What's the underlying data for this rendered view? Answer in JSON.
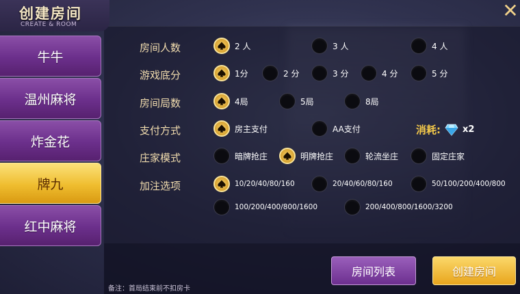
{
  "header": {
    "title": "创建房间",
    "subtitle": "CREATE & ROOM",
    "close_icon": "close-icon"
  },
  "sidebar": {
    "items": [
      {
        "label": "牛牛",
        "active": false
      },
      {
        "label": "温州麻将",
        "active": false
      },
      {
        "label": "炸金花",
        "active": false
      },
      {
        "label": "牌九",
        "active": true
      },
      {
        "label": "红中麻将",
        "active": false
      }
    ]
  },
  "form": {
    "players": {
      "label": "房间人数",
      "options": [
        {
          "label": "2 人",
          "selected": true
        },
        {
          "label": "3 人",
          "selected": false
        },
        {
          "label": "4 人",
          "selected": false
        }
      ]
    },
    "base_score": {
      "label": "游戏底分",
      "options": [
        {
          "label": "1分",
          "selected": true
        },
        {
          "label": "2 分",
          "selected": false
        },
        {
          "label": "3 分",
          "selected": false
        },
        {
          "label": "4 分",
          "selected": false
        },
        {
          "label": "5 分",
          "selected": false
        }
      ]
    },
    "rounds": {
      "label": "房间局数",
      "options": [
        {
          "label": "4局",
          "selected": true
        },
        {
          "label": "5局",
          "selected": false
        },
        {
          "label": "8局",
          "selected": false
        }
      ]
    },
    "payment": {
      "label": "支付方式",
      "options": [
        {
          "label": "房主支付",
          "selected": true
        },
        {
          "label": "AA支付",
          "selected": false
        }
      ],
      "cost_label": "消耗:",
      "cost_icon": "diamond-icon",
      "cost_value": "x2"
    },
    "dealer": {
      "label": "庄家模式",
      "options": [
        {
          "label": "暗牌抢庄",
          "selected": false
        },
        {
          "label": "明牌抢庄",
          "selected": true
        },
        {
          "label": "轮流坐庄",
          "selected": false
        },
        {
          "label": "固定庄家",
          "selected": false
        }
      ]
    },
    "bets": {
      "label": "加注选项",
      "options": [
        {
          "label": "10/20/40/80/160",
          "selected": true
        },
        {
          "label": "20/40/60/80/160",
          "selected": false
        },
        {
          "label": "50/100/200/400/800",
          "selected": false
        },
        {
          "label": "100/200/400/800/1600",
          "selected": false
        },
        {
          "label": "200/400/800/1600/3200",
          "selected": false
        }
      ]
    }
  },
  "buttons": {
    "room_list": "房间列表",
    "create_room": "创建房间"
  },
  "note": "备注：首局结束前不扣房卡",
  "colors": {
    "accent_gold": "#f4c94a",
    "label_text": "#f1dcae",
    "purple": "#6c2f8f"
  }
}
